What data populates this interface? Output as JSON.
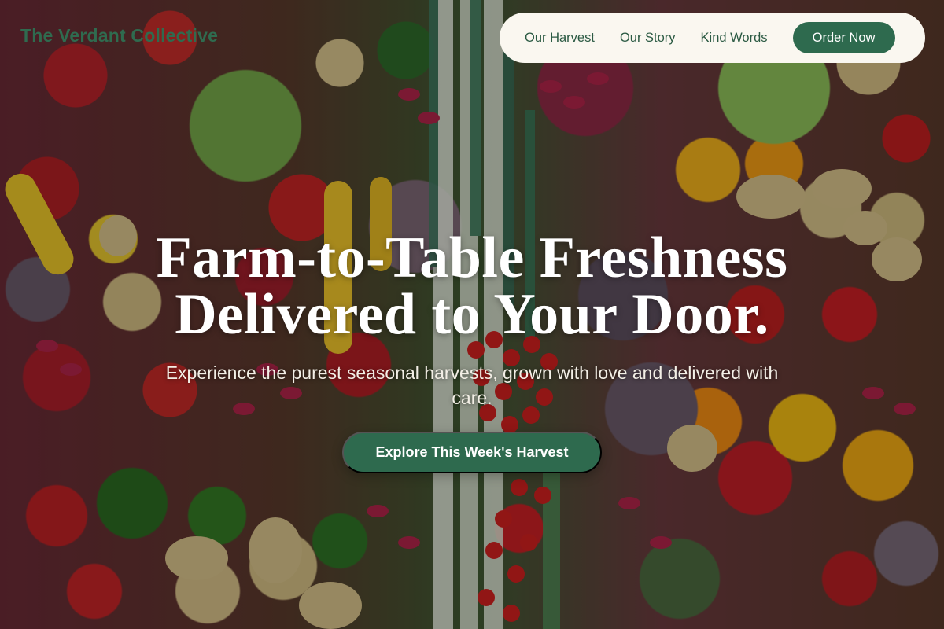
{
  "brand": {
    "name": "The Verdant Collective"
  },
  "nav": {
    "links": [
      {
        "label": "Our Harvest"
      },
      {
        "label": "Our Story"
      },
      {
        "label": "Kind Words"
      }
    ],
    "order_button": "Order Now"
  },
  "hero": {
    "headline_line1": "Farm-to-Table Freshness",
    "headline_line2": "Delivered to Your Door.",
    "subheadline": "Experience the purest seasonal harvests, grown with love and delivered with care.",
    "cta_label": "Explore This Week's Harvest",
    "background_image": "colorful-vegetables-market-photo"
  },
  "colors": {
    "accent_green": "#2e6a4e",
    "nav_background": "#faf7f0",
    "headline_text": "#ffffff"
  }
}
